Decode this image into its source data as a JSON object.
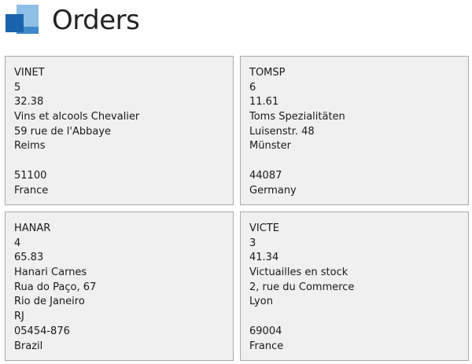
{
  "page": {
    "title": "Orders"
  },
  "orders": [
    {
      "customer_id": "VINET",
      "employee_id": "5",
      "freight": "32.38",
      "ship_name": "Vins et alcools Chevalier",
      "ship_address": "59 rue de l'Abbaye",
      "ship_city": "Reims",
      "ship_region": "",
      "ship_postal_code": "51100",
      "ship_country": "France"
    },
    {
      "customer_id": "TOMSP",
      "employee_id": "6",
      "freight": "11.61",
      "ship_name": "Toms Spezialitäten",
      "ship_address": "Luisenstr. 48",
      "ship_city": "Münster",
      "ship_region": "",
      "ship_postal_code": "44087",
      "ship_country": "Germany"
    },
    {
      "customer_id": "HANAR",
      "employee_id": "4",
      "freight": "65.83",
      "ship_name": "Hanari Carnes",
      "ship_address": "Rua do Paço, 67",
      "ship_city": "Rio de Janeiro",
      "ship_region": "RJ",
      "ship_postal_code": "05454-876",
      "ship_country": "Brazil"
    },
    {
      "customer_id": "VICTE",
      "employee_id": "3",
      "freight": "41.34",
      "ship_name": "Victuailles en stock",
      "ship_address": "2, rue du Commerce",
      "ship_city": "Lyon",
      "ship_region": "",
      "ship_postal_code": "69004",
      "ship_country": "France"
    }
  ],
  "colors": {
    "logo_dark": "#1a63ad",
    "logo_light": "#8ebfe6",
    "card_background": "#f0f0f0",
    "card_border": "#a9a9a9"
  }
}
